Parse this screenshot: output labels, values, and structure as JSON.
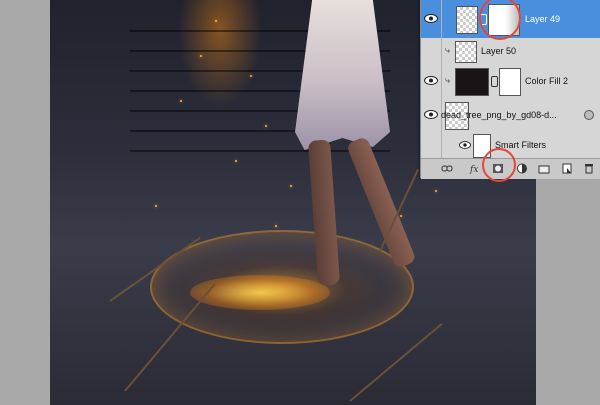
{
  "layers_panel": {
    "layers": [
      {
        "name": "Layer 49",
        "selected": true
      },
      {
        "name": "Layer 50",
        "selected": false
      },
      {
        "name": "Color Fill 2",
        "selected": false
      },
      {
        "name": "dead_tree_png_by_gd08-d...",
        "selected": false
      },
      {
        "name": "Smart Filters",
        "selected": false
      }
    ],
    "footer_icons": [
      "link-icon",
      "fx-icon",
      "add-mask-icon",
      "adjustment-layer-icon",
      "group-folder-icon",
      "new-layer-icon",
      "trash-icon"
    ]
  },
  "colors": {
    "selection": "#4a8fde",
    "highlight_circle": "#e4463c",
    "panel_bg": "#d6d6d6"
  }
}
